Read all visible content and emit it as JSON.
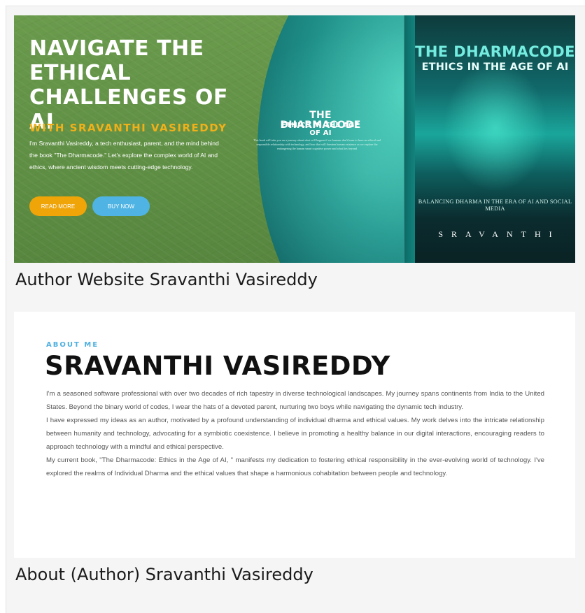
{
  "hero": {
    "title_lines": [
      "NAVIGATE THE",
      "ETHICAL",
      "CHALLENGES OF AI"
    ],
    "subtitle": "WITH SRAVANTHI VASIREDDY",
    "description": "I'm Sravanthi Vasireddy, a tech enthusiast, parent, and the mind behind the book \"The Dharmacode.\" Let's explore the complex world of AI and ethics, where ancient wisdom meets cutting-edge technology.",
    "buttons": {
      "read_more": "READ MORE",
      "buy_now": "BUY NOW"
    },
    "cover_small": {
      "title": "THE DHARMACODE",
      "subtitle": "ETHICS IN THE AGE OF AI",
      "blurb": "This book will take you on a journey about what will happen if we humans don't learn to have an ethical and responsible relationship with technology, and how that will threaten human existence as we explore the endangering the human smart cognitive power and what lies beyond"
    },
    "book": {
      "title": "THE DHARMACODE",
      "subtitle": "ETHICS IN THE AGE OF AI",
      "tagline": "BALANCING DHARMA IN THE ERA OF AI AND SOCIAL MEDIA",
      "author": "SRAVANTHI"
    },
    "colors": {
      "accent_yellow": "#efa408",
      "accent_blue": "#4fb4e4",
      "hero_green": "#62924a"
    }
  },
  "captions": {
    "first": "Author Website Sravanthi Vasireddy",
    "second": "About (Author) Sravanthi Vasireddy"
  },
  "about": {
    "label": "ABOUT ME",
    "name": "SRAVANTHI VASIREDDY",
    "paragraphs": [
      "I'm a seasoned software professional with over two decades of rich tapestry in diverse technological landscapes. My journey spans continents from India to the United States. Beyond the binary world of codes, I wear the hats of a devoted parent, nurturing two boys while navigating the dynamic tech industry.",
      "I have expressed my ideas as an author, motivated by a profound understanding of individual dharma and ethical values. My work delves into the intricate relationship between humanity and technology, advocating for a symbiotic coexistence. I believe in promoting a healthy balance in our digital interactions, encouraging readers to approach technology with a mindful and ethical perspective.",
      "My current book, \"The Dharmacode: Ethics in the Age of AI, \" manifests my dedication to fostering ethical responsibility in the ever-evolving world of technology. I've explored the realms of Individual Dharma and the ethical values that shape a harmonious cohabitation between people and technology."
    ]
  }
}
